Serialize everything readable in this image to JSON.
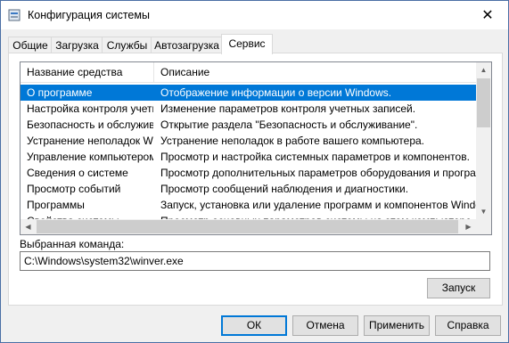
{
  "window": {
    "title": "Конфигурация системы"
  },
  "tabs": [
    {
      "label": "Общие"
    },
    {
      "label": "Загрузка"
    },
    {
      "label": "Службы"
    },
    {
      "label": "Автозагрузка"
    },
    {
      "label": "Сервис"
    }
  ],
  "tools": {
    "columns": {
      "name": "Название средства",
      "description": "Описание"
    },
    "selected_index": 0,
    "rows": [
      {
        "name": "О программе",
        "description": "Отображение информации о версии Windows."
      },
      {
        "name": "Настройка контроля учетн...",
        "description": "Изменение параметров контроля учетных записей."
      },
      {
        "name": "Безопасность и обслужива...",
        "description": "Открытие раздела \"Безопасность и обслуживание\"."
      },
      {
        "name": "Устранение неполадок Wi...",
        "description": "Устранение неполадок в работе вашего компьютера."
      },
      {
        "name": "Управление компьютером",
        "description": "Просмотр и настройка системных параметров и компонентов."
      },
      {
        "name": "Сведения о системе",
        "description": "Просмотр дополнительных параметров оборудования и программн"
      },
      {
        "name": "Просмотр событий",
        "description": "Просмотр сообщений наблюдения и диагностики."
      },
      {
        "name": "Программы",
        "description": "Запуск, установка или удаление программ и компонентов Windows."
      },
      {
        "name": "Свойства системы",
        "description": "Просмотр основных параметров системы на этом компьютере."
      }
    ]
  },
  "command": {
    "label": "Выбранная команда:",
    "value": "C:\\Windows\\system32\\winver.exe"
  },
  "buttons": {
    "launch": "Запуск",
    "ok": "ОК",
    "cancel": "Отмена",
    "apply": "Применить",
    "help": "Справка"
  },
  "colors": {
    "selection": "#0078d7",
    "accent_border": "#0078d7"
  }
}
